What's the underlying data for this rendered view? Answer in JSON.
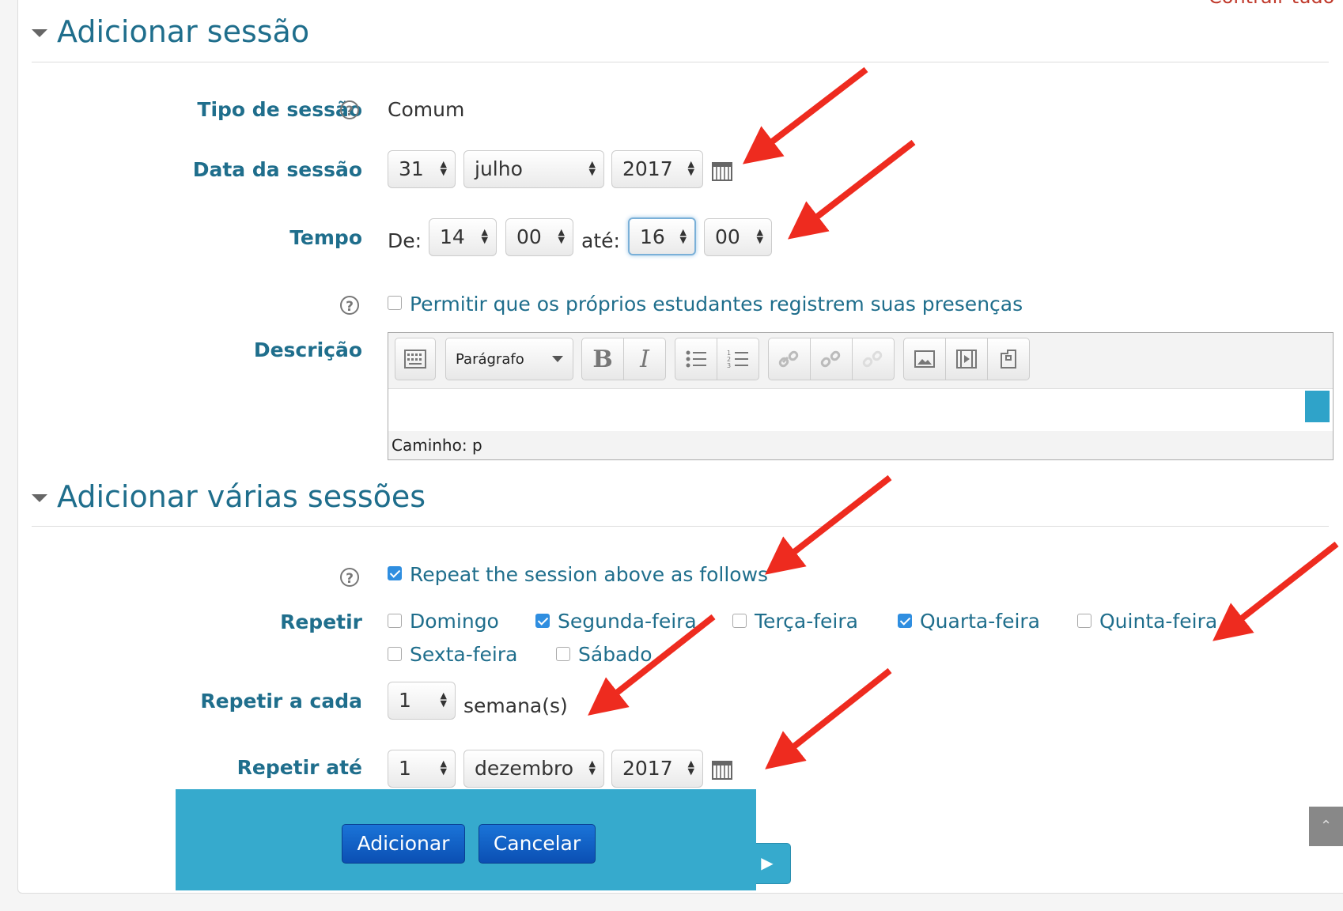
{
  "header": {
    "collapse_all": "Contrair tudo"
  },
  "section1": {
    "title": "Adicionar sessão",
    "session_type": {
      "label": "Tipo de sessão",
      "value": "Comum"
    },
    "session_date": {
      "label": "Data da sessão",
      "day": "31",
      "month": "julho",
      "year": "2017"
    },
    "time": {
      "label": "Tempo",
      "from_label": "De:",
      "from_hour": "14",
      "from_min": "00",
      "to_label": "até:",
      "to_hour": "16",
      "to_min": "00"
    },
    "self_marking": {
      "label": "Permitir que os próprios estudantes registrem suas presenças",
      "checked": false
    },
    "description": {
      "label": "Descrição",
      "format": "Parágrafo",
      "path": "Caminho: p"
    }
  },
  "section2": {
    "title": "Adicionar várias sessões",
    "repeat_toggle": {
      "label": "Repeat the session above as follows",
      "checked": true
    },
    "repeat": {
      "label": "Repetir",
      "days": [
        {
          "label": "Domingo",
          "checked": false
        },
        {
          "label": "Segunda-feira",
          "checked": true
        },
        {
          "label": "Terça-feira",
          "checked": false
        },
        {
          "label": "Quarta-feira",
          "checked": true
        },
        {
          "label": "Quinta-feira",
          "checked": false
        },
        {
          "label": "Sexta-feira",
          "checked": false
        },
        {
          "label": "Sábado",
          "checked": false
        }
      ]
    },
    "repeat_every": {
      "label": "Repetir a cada",
      "value": "1",
      "unit": "semana(s)"
    },
    "repeat_until": {
      "label": "Repetir até",
      "day": "1",
      "month": "dezembro",
      "year": "2017"
    }
  },
  "buttons": {
    "add": "Adicionar",
    "cancel": "Cancelar"
  },
  "colors": {
    "accent": "#1f6e8c",
    "primary_button": "#0b4fb3",
    "footer_bar": "#36aacd",
    "annotation_arrow": "#ee2b1f"
  }
}
